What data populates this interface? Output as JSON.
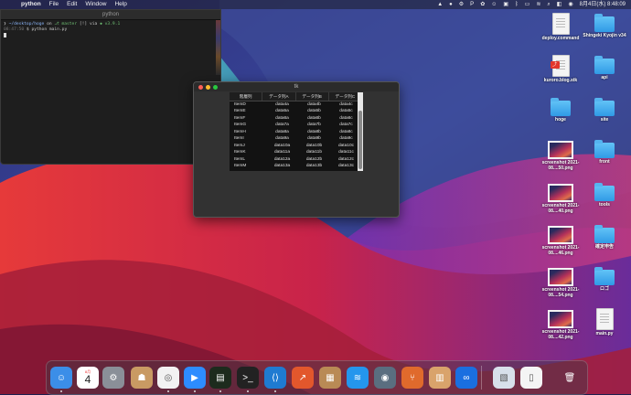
{
  "menubar": {
    "app": "python",
    "items": [
      "File",
      "Edit",
      "Window",
      "Help"
    ],
    "status_letter": "P",
    "datetime": "8月4日(水)  8:48:09"
  },
  "terminal": {
    "title": "python",
    "prompt_path": "~/desktop/hoge",
    "prompt_on": "on",
    "branch": "master",
    "branch_state": "[!]",
    "via": "via",
    "version": "v3.9.1",
    "time": "08:47:50",
    "command": "python main.py"
  },
  "tk": {
    "title": "tk",
    "columns": [
      "階層列",
      "データ列A",
      "データ列B",
      "データ列C"
    ],
    "rows": [
      [
        "ItemD",
        "data4a",
        "data4b",
        "data4c"
      ],
      [
        "ItemE",
        "data5a",
        "data5b",
        "data5c"
      ],
      [
        "ItemF",
        "data6a",
        "data6b",
        "data6c"
      ],
      [
        "ItemG",
        "data7a",
        "data7b",
        "data7c"
      ],
      [
        "ItemH",
        "data8a",
        "data8b",
        "data8c"
      ],
      [
        "ItemI",
        "data9a",
        "data9b",
        "data9c"
      ],
      [
        "ItemJ",
        "data10a",
        "data10b",
        "data10c"
      ],
      [
        "ItemK",
        "data11a",
        "data11b",
        "data11c"
      ],
      [
        "ItemL",
        "data12a",
        "data12b",
        "data12c"
      ],
      [
        "ItemM",
        "data13a",
        "data13b",
        "data13c"
      ]
    ]
  },
  "desktop": {
    "icons": [
      {
        "label": "deploy.command",
        "kind": "doc"
      },
      {
        "label": "Shingeki Kyojin v34",
        "kind": "folder"
      },
      {
        "label": "kuroro.blog.stk",
        "kind": "doc-badge"
      },
      {
        "label": "api",
        "kind": "folder"
      },
      {
        "label": "hoge",
        "kind": "folder"
      },
      {
        "label": "site",
        "kind": "folder"
      },
      {
        "label": "screenshot 2021-08....50.png",
        "kind": "shot"
      },
      {
        "label": "front",
        "kind": "folder"
      },
      {
        "label": "screenshot 2021-08....40.png",
        "kind": "shot"
      },
      {
        "label": "tools",
        "kind": "folder"
      },
      {
        "label": "screenshot 2021-08....46.png",
        "kind": "shot"
      },
      {
        "label": "確定申告",
        "kind": "folder"
      },
      {
        "label": "screenshot 2021-08....54.png",
        "kind": "shot"
      },
      {
        "label": "ロゴ",
        "kind": "folder"
      },
      {
        "label": "screenshot 2021-08....42.png",
        "kind": "shot"
      },
      {
        "label": "main.py",
        "kind": "doc"
      }
    ]
  },
  "dock": {
    "calendar_month": "8月",
    "calendar_day": "4",
    "apps": [
      {
        "name": "finder-icon",
        "color": "#3b8ee8"
      },
      {
        "name": "calendar-icon",
        "color": "#ffffff"
      },
      {
        "name": "system-preferences-icon",
        "color": "#8a8f98"
      },
      {
        "name": "contacts-icon",
        "color": "#c99a63"
      },
      {
        "name": "chrome-icon",
        "color": "#f2f2f2"
      },
      {
        "name": "zoom-icon",
        "color": "#2d8cff"
      },
      {
        "name": "terminal-alt-icon",
        "color": "#1d2b1d"
      },
      {
        "name": "terminal-icon",
        "color": "#222222"
      },
      {
        "name": "vscode-icon",
        "color": "#1f7bd1"
      },
      {
        "name": "instruments-icon",
        "color": "#e2572c"
      },
      {
        "name": "archive-utility-icon",
        "color": "#b98a55"
      },
      {
        "name": "docker-icon",
        "color": "#2496ed"
      },
      {
        "name": "quicktime-icon",
        "color": "#5a6e80"
      },
      {
        "name": "sourcetree-icon",
        "color": "#e06a2c"
      },
      {
        "name": "keynote-icon",
        "color": "#d9a36b"
      },
      {
        "name": "infinity-icon",
        "color": "#1a6fe0"
      },
      {
        "name": "preview-icon",
        "color": "#d8e0ea"
      },
      {
        "name": "document-icon",
        "color": "#f4f4f4"
      },
      {
        "name": "trash-icon",
        "color": "#9aa0a8"
      }
    ]
  }
}
